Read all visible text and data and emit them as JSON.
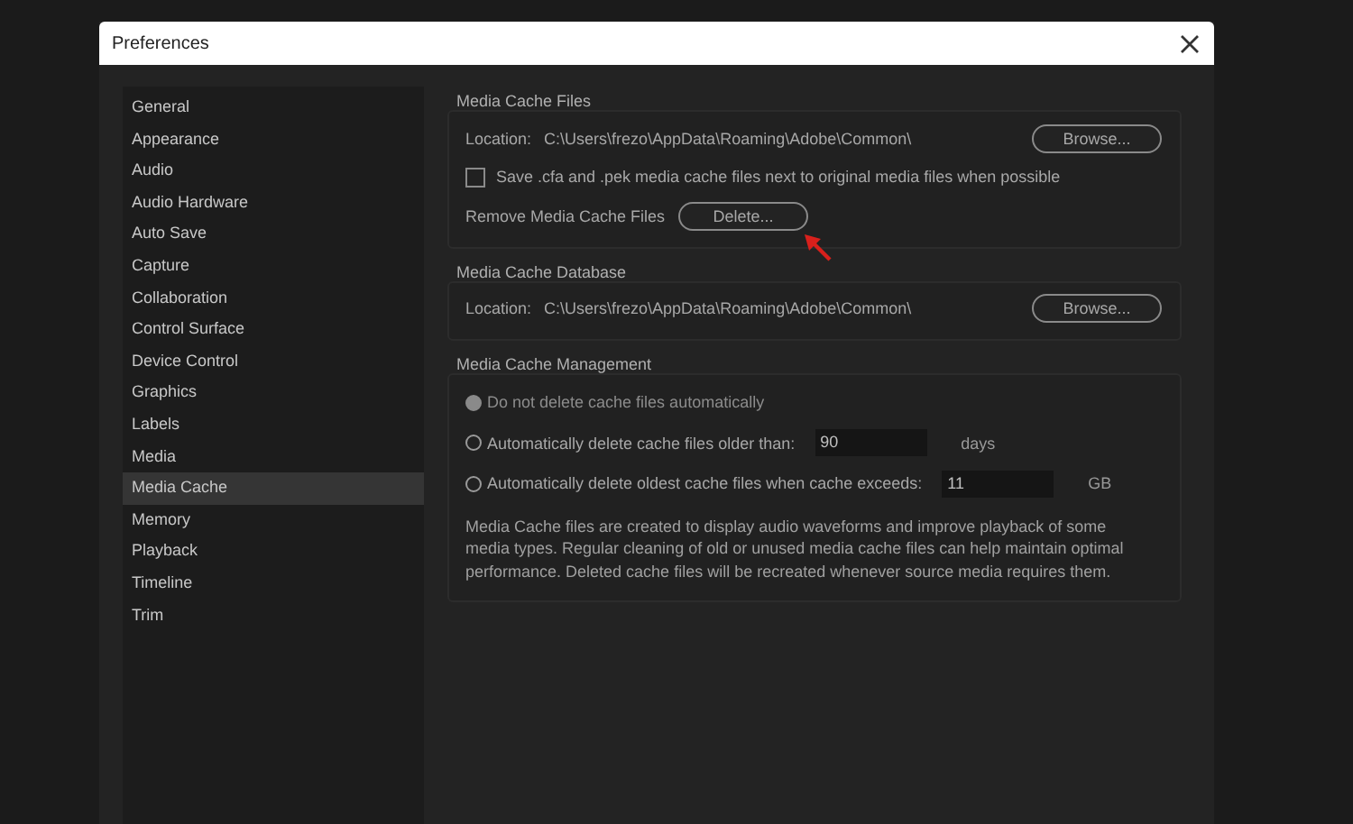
{
  "window": {
    "title": "Preferences"
  },
  "sidebar": {
    "items": [
      {
        "label": "General",
        "selected": false
      },
      {
        "label": "Appearance",
        "selected": false
      },
      {
        "label": "Audio",
        "selected": false
      },
      {
        "label": "Audio Hardware",
        "selected": false
      },
      {
        "label": "Auto Save",
        "selected": false
      },
      {
        "label": "Capture",
        "selected": false
      },
      {
        "label": "Collaboration",
        "selected": false
      },
      {
        "label": "Control Surface",
        "selected": false
      },
      {
        "label": "Device Control",
        "selected": false
      },
      {
        "label": "Graphics",
        "selected": false
      },
      {
        "label": "Labels",
        "selected": false
      },
      {
        "label": "Media",
        "selected": false
      },
      {
        "label": "Media Cache",
        "selected": true
      },
      {
        "label": "Memory",
        "selected": false
      },
      {
        "label": "Playback",
        "selected": false
      },
      {
        "label": "Timeline",
        "selected": false
      },
      {
        "label": "Trim",
        "selected": false
      }
    ]
  },
  "sections": [
    {
      "title": "Media Cache Files",
      "rows": [
        {
          "kind": "location",
          "label": "Location:",
          "path": "C:\\Users\\frezo\\AppData\\Roaming\\Adobe\\Common\\",
          "button": "Browse..."
        },
        {
          "kind": "checkbox",
          "label": "Save .cfa and .pek media cache files next to original media files when possible",
          "checked": false
        },
        {
          "kind": "action",
          "label": "Remove Media Cache Files",
          "button": "Delete...",
          "annotated": true
        }
      ]
    },
    {
      "title": "Media Cache Database",
      "rows": [
        {
          "kind": "location",
          "label": "Location:",
          "path": "C:\\Users\\frezo\\AppData\\Roaming\\Adobe\\Common\\",
          "button": "Browse..."
        }
      ]
    },
    {
      "title": "Media Cache Management",
      "rows": [
        {
          "kind": "radio",
          "label": "Do not delete cache files automatically",
          "selected": true
        },
        {
          "kind": "radio",
          "label": "Automatically delete cache files older than:",
          "selected": false,
          "value": "90",
          "unit": "days"
        },
        {
          "kind": "radio",
          "label": "Automatically delete oldest cache files when cache exceeds:",
          "selected": false,
          "value": "11",
          "unit": "GB"
        },
        {
          "kind": "note",
          "text": "Media Cache files are created to display audio waveforms and improve playback of some media types.  Regular cleaning of old or unused media cache files can help maintain optimal performance. Deleted cache files will be recreated whenever source media requires them."
        }
      ]
    }
  ]
}
